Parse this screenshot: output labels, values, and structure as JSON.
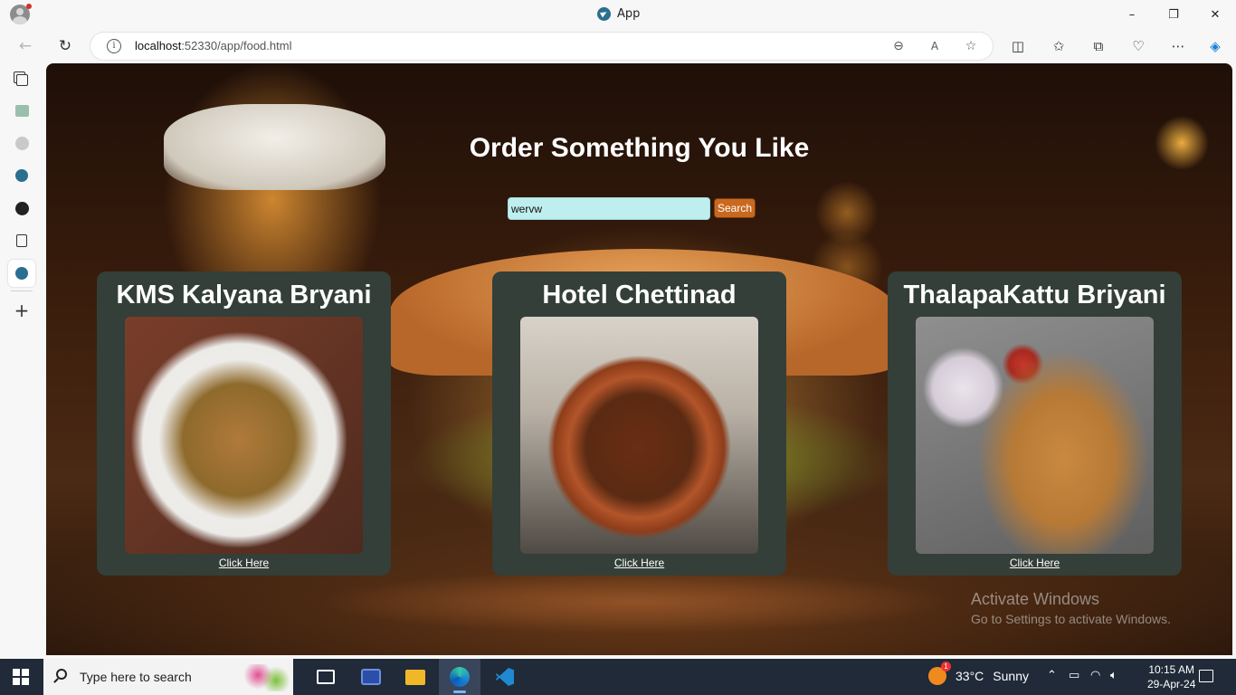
{
  "window": {
    "tab_title": "App",
    "controls": [
      "–",
      "❐",
      "✕"
    ]
  },
  "address_bar": {
    "url_host": "localhost",
    "url_rest": ":52330/app/food.html"
  },
  "page": {
    "title": "Order Something You Like",
    "search": {
      "value": "wervw",
      "button_label": "Search"
    },
    "cards": [
      {
        "title": "KMS Kalyana Bryani",
        "link_label": "Click Here"
      },
      {
        "title": "Hotel Chettinad",
        "link_label": "Click Here"
      },
      {
        "title": "ThalapaKattu Briyani",
        "link_label": "Click Here"
      }
    ]
  },
  "watermark": {
    "line1": "Activate Windows",
    "line2": "Go to Settings to activate Windows."
  },
  "taskbar": {
    "search_placeholder": "Type here to search",
    "weather_temp": "33°C",
    "weather_condition": "Sunny",
    "weather_badge": "1",
    "time": "10:15 AM",
    "date": "29-Apr-24"
  },
  "colors": {
    "card_bg": "#333f38",
    "search_input_bg": "#bfeeee",
    "search_button_bg": "#c9691f",
    "taskbar_bg": "#202a38"
  }
}
